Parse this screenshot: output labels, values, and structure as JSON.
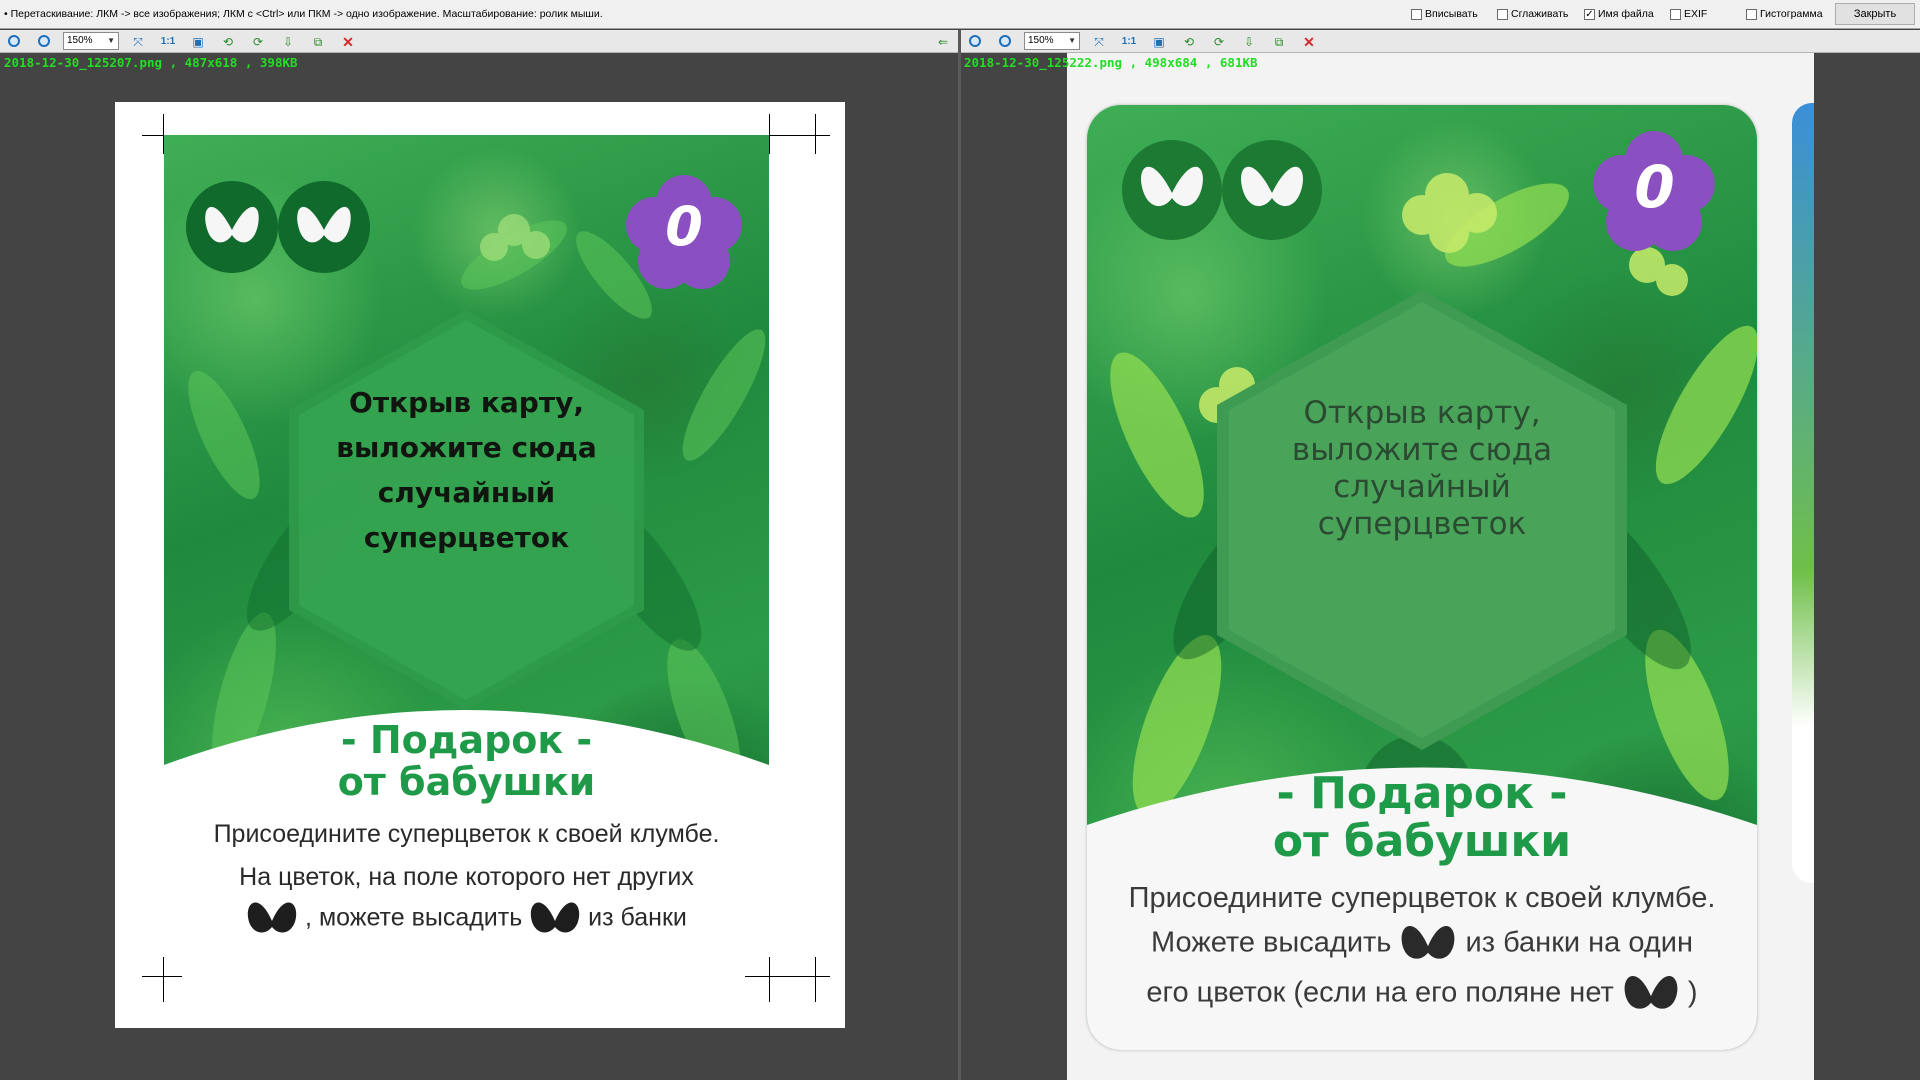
{
  "topbar": {
    "hint": "• Перетаскивание: ЛКМ -> все изображения; ЛКМ с <Ctrl> или ПКМ -> одно изображение. Масштабирование: ролик мыши.",
    "options": [
      {
        "label": "Вписывать",
        "checked": false
      },
      {
        "label": "Сглаживать",
        "checked": false
      },
      {
        "label": "Имя файла",
        "checked": true
      },
      {
        "label": "EXIF",
        "checked": false
      },
      {
        "label": "Гистограмма",
        "checked": false
      }
    ],
    "close_label": "Закрыть"
  },
  "left_pane": {
    "zoom": "150%",
    "fit_label": "1:1",
    "file_name": "2018-12-30_125207.png",
    "dimensions": "487x618",
    "size": "398KB",
    "card": {
      "badge_number": "0",
      "hex_text": [
        "Открыв карту,",
        "выложите сюда",
        "случайный",
        "суперцветок"
      ],
      "title_lines": [
        "- Подарок -",
        "от бабушки"
      ],
      "rule_1": "Присоедините суперцветок к своей клумбе.",
      "rule_2": "На цветок, на поле которого нет других",
      "rule_3a": ", можете высадить",
      "rule_3b": "из банки"
    }
  },
  "right_pane": {
    "zoom": "150%",
    "fit_label": "1:1",
    "file_name": "2018-12-30_125222.png",
    "dimensions": "498x684",
    "size": "681KB",
    "card": {
      "badge_number": "0",
      "hex_text": [
        "Открыв карту,",
        "выложите сюда",
        "случайный",
        "суперцветок"
      ],
      "title_lines": [
        "- Подарок -",
        "от бабушки"
      ],
      "rule_1": "Присоедините суперцветок к своей клумбе.",
      "rule_2a": "Можете высадить",
      "rule_2b": "из банки на один",
      "rule_3a": "его цветок (если на его поляне нет",
      "rule_3b": ")"
    }
  },
  "colors": {
    "title_green": "#1e9a49",
    "filename_green": "#22dd22",
    "badge_purple": "#8a4fc0",
    "background": "#444444"
  }
}
